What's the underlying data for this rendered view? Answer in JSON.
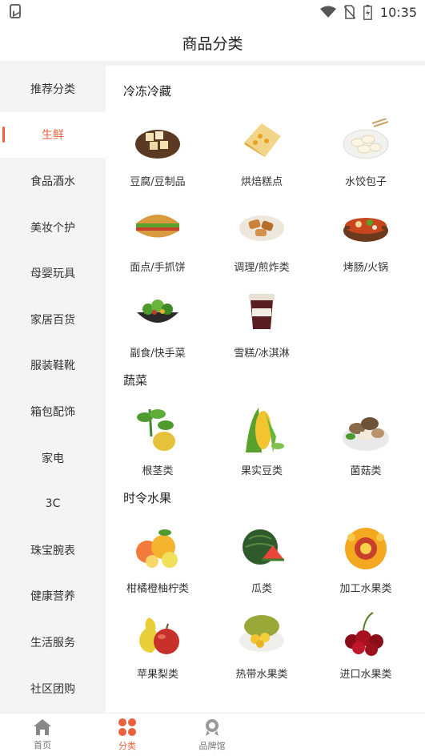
{
  "status_bar": {
    "time": "10:35"
  },
  "header": {
    "title": "商品分类"
  },
  "sidebar": {
    "items": [
      {
        "label": "推荐分类"
      },
      {
        "label": "生鲜",
        "active": true
      },
      {
        "label": "食品酒水"
      },
      {
        "label": "美妆个护"
      },
      {
        "label": "母婴玩具"
      },
      {
        "label": "家居百货"
      },
      {
        "label": "服装鞋靴"
      },
      {
        "label": "箱包配饰"
      },
      {
        "label": "家电"
      },
      {
        "label": "3C"
      },
      {
        "label": "珠宝腕表"
      },
      {
        "label": "健康营养"
      },
      {
        "label": "生活服务"
      },
      {
        "label": "社区团购"
      }
    ]
  },
  "sections": [
    {
      "title": "冷冻冷藏",
      "items": [
        {
          "label": "豆腐/豆制品",
          "icon": "tofu-icon"
        },
        {
          "label": "烘焙糕点",
          "icon": "cake-icon"
        },
        {
          "label": "水饺包子",
          "icon": "dumpling-icon"
        },
        {
          "label": "面点/手抓饼",
          "icon": "pancake-icon"
        },
        {
          "label": "调理/煎炸类",
          "icon": "fried-food-icon"
        },
        {
          "label": "烤肠/火锅",
          "icon": "hotpot-icon"
        },
        {
          "label": "副食/快手菜",
          "icon": "salad-icon"
        },
        {
          "label": "雪糕/冰淇淋",
          "icon": "icecream-icon"
        }
      ]
    },
    {
      "title": "蔬菜",
      "items": [
        {
          "label": "根茎类",
          "icon": "root-vegetable-icon"
        },
        {
          "label": "果实豆类",
          "icon": "corn-icon"
        },
        {
          "label": "菌菇类",
          "icon": "mushroom-icon"
        }
      ]
    },
    {
      "title": "时令水果",
      "items": [
        {
          "label": "柑橘橙柚柠类",
          "icon": "citrus-icon"
        },
        {
          "label": "瓜类",
          "icon": "watermelon-icon"
        },
        {
          "label": "加工水果类",
          "icon": "fruit-platter-icon"
        },
        {
          "label": "苹果梨类",
          "icon": "apple-pear-icon"
        },
        {
          "label": "热带水果类",
          "icon": "jackfruit-icon"
        },
        {
          "label": "进口水果类",
          "icon": "cherry-icon"
        }
      ]
    }
  ],
  "tabbar": {
    "items": [
      {
        "label": "首页",
        "icon": "home-icon"
      },
      {
        "label": "分类",
        "icon": "category-icon",
        "active": true
      },
      {
        "label": "品牌馆",
        "icon": "brand-icon"
      },
      {
        "label": "",
        "icon": ""
      },
      {
        "label": "",
        "icon": ""
      }
    ]
  },
  "colors": {
    "accent": "#e8623d"
  }
}
